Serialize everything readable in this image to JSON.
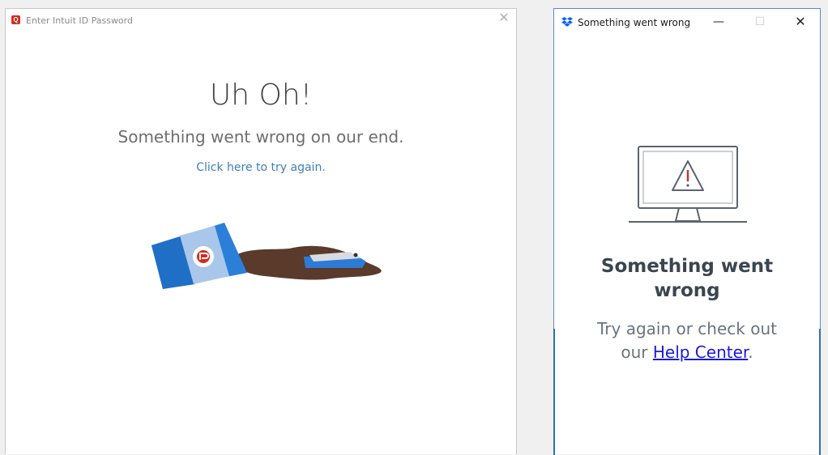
{
  "left_window": {
    "title": "Enter Intuit ID Password",
    "app_icon_glyph": "Q",
    "close_glyph": "✕",
    "heading": "Uh Oh!",
    "subheading": "Something went wrong on our end.",
    "retry_link": "Click here to try again.",
    "illustration": "spilled-coffee-cup",
    "colors": {
      "link": "#3f7fbf",
      "brand": "#d52b1e"
    }
  },
  "right_window": {
    "title": "Something went wrong",
    "controls": {
      "minimize": "—",
      "maximize": "☐",
      "close": "✕"
    },
    "illustration": "monitor-warning",
    "heading_line1": "Something went",
    "heading_line2": "wrong",
    "message_line1": "Try again or check out",
    "message_line2_prefix": "our ",
    "help_link": "Help Center",
    "message_line2_suffix": ".",
    "colors": {
      "brand": "#0061fe",
      "link": "#1a1adc"
    }
  }
}
